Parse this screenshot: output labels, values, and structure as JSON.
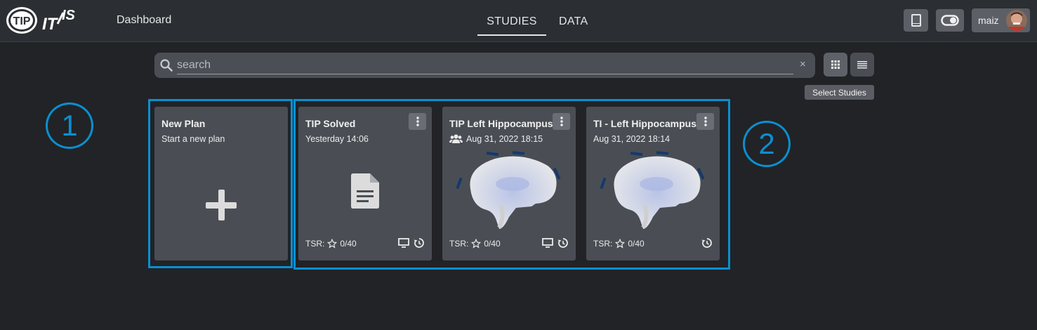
{
  "header": {
    "logo_text": "TIP IT'IS",
    "dashboard_label": "Dashboard",
    "tabs": [
      {
        "label": "STUDIES",
        "active": true
      },
      {
        "label": "DATA",
        "active": false
      }
    ],
    "user_name": "maiz",
    "icons": [
      "book-icon",
      "toggle-icon",
      "avatar"
    ]
  },
  "search": {
    "placeholder": "search",
    "clear_glyph": "×"
  },
  "view": {
    "grid_icon": "grid-icon",
    "list_icon": "list-icon",
    "tooltip": "Select Studies"
  },
  "cards": [
    {
      "title": "New Plan",
      "subtitle": "Start a new plan",
      "icon": "plus-icon"
    },
    {
      "title": "TIP Solved",
      "date": "Yesterday 14:06",
      "tsr_label": "TSR:",
      "tsr_value": "0/40",
      "thumbnail": "document-icon",
      "icons": [
        "monitor-icon",
        "history-icon"
      ]
    },
    {
      "title": "TIP Left Hippocampus",
      "date": "Aug 31, 2022 18:15",
      "shared": true,
      "tsr_label": "TSR:",
      "tsr_value": "0/40",
      "thumbnail": "brain-image",
      "icons": [
        "monitor-icon",
        "history-icon"
      ]
    },
    {
      "title": "TI - Left Hippocampus",
      "date": "Aug 31, 2022 18:14",
      "tsr_label": "TSR:",
      "tsr_value": "0/40",
      "thumbnail": "brain-image",
      "icons": [
        "history-icon"
      ]
    }
  ],
  "annotations": {
    "callout_1": "1",
    "callout_2": "2",
    "color": "#0a8fd1"
  },
  "colors": {
    "background": "#212326",
    "topbar": "#2b2e32",
    "card": "#4a4e54",
    "accent": "#0a8fd1"
  }
}
